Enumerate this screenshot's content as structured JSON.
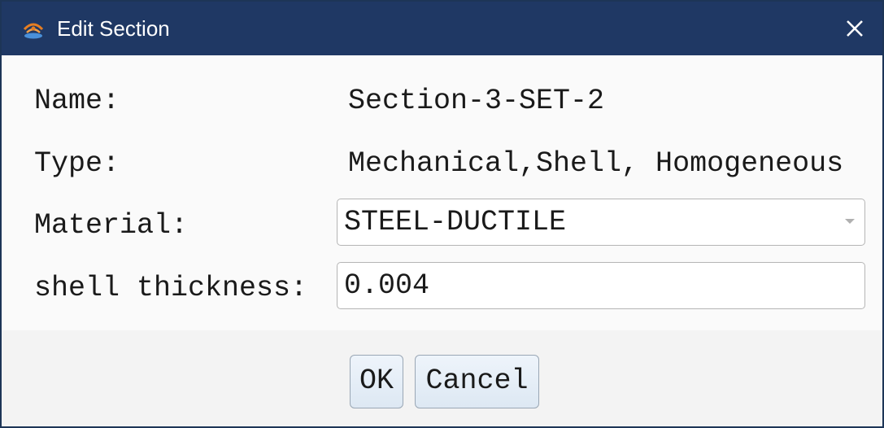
{
  "window": {
    "title": "Edit Section",
    "app_icon": "app-logo-icon",
    "close_icon": "close-icon"
  },
  "form": {
    "name_label": "Name:",
    "name_value": "Section-3-SET-2",
    "type_label": "Type:",
    "type_value": "Mechanical,Shell, Homogeneous",
    "material_label": "Material:",
    "material_value": "STEEL-DUCTILE",
    "thickness_label": "shell thickness:",
    "thickness_value": "0.004"
  },
  "buttons": {
    "ok_label": "OK",
    "cancel_label": "Cancel"
  },
  "colors": {
    "titlebar": "#1f3864",
    "accent_icon": "#e67e22"
  }
}
